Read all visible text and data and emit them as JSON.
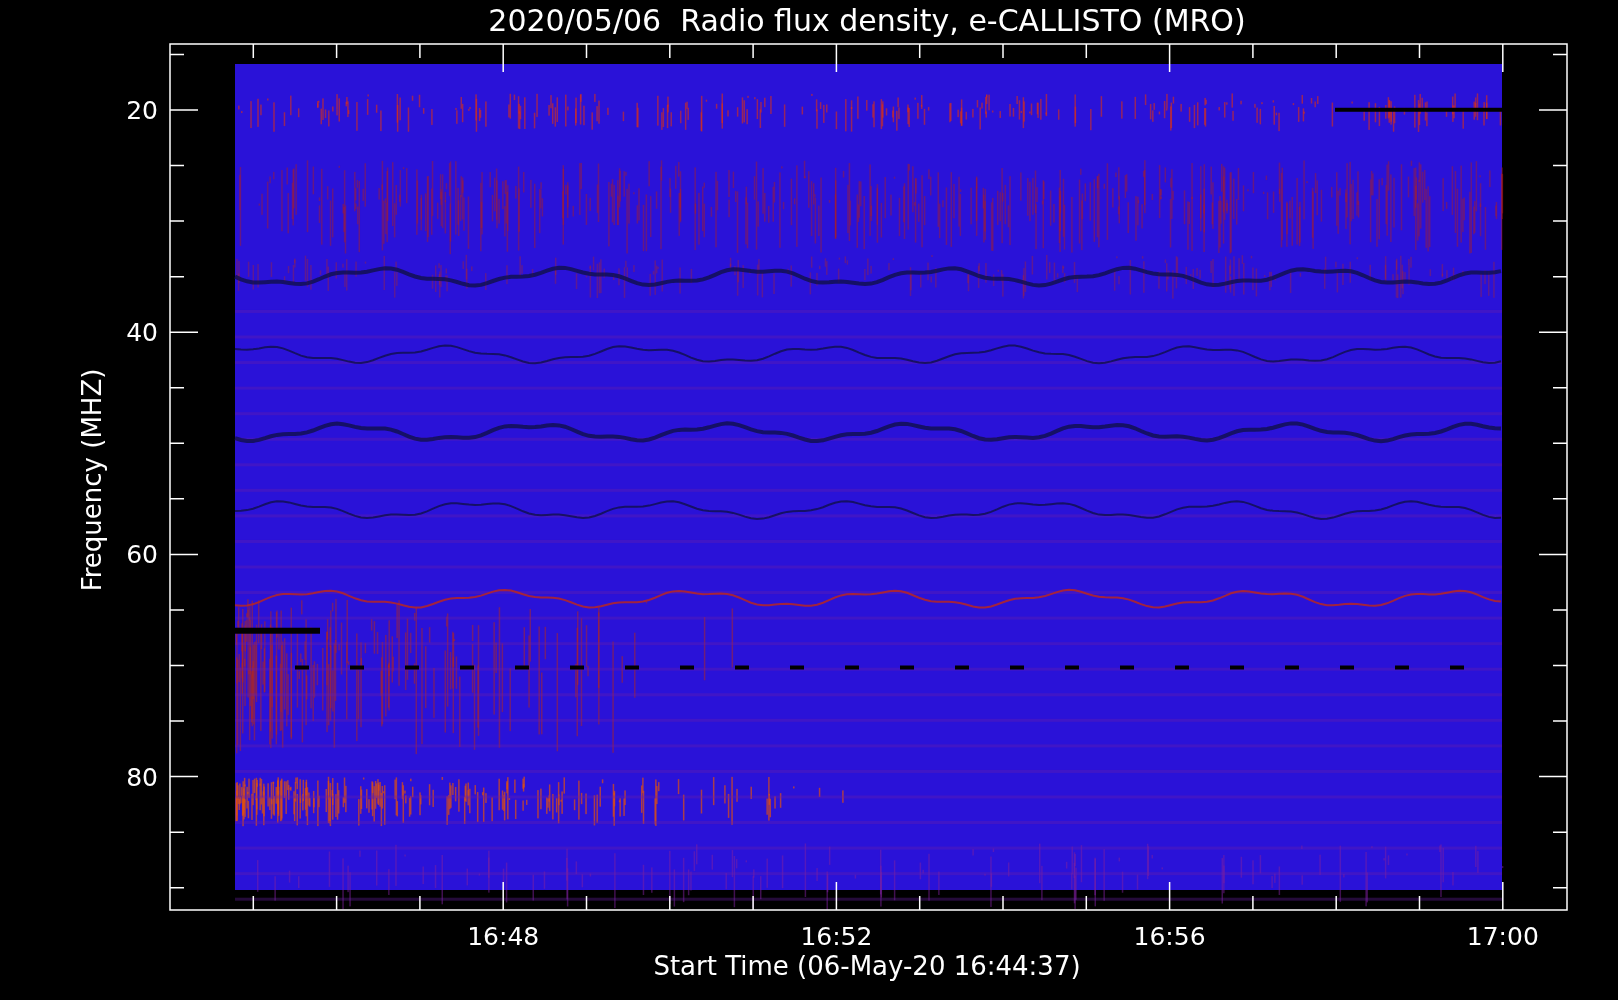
{
  "title": "2020/05/06  Radio flux density, e-CALLISTO (MRO)",
  "y_axis": {
    "label": "Frequency (MHZ)",
    "ticks": [
      "20",
      "40",
      "60",
      "80"
    ]
  },
  "x_axis": {
    "label": "Start Time (06-May-20 16:44:37)",
    "ticks": [
      "16:48",
      "16:52",
      "16:56",
      "17:00"
    ]
  }
}
